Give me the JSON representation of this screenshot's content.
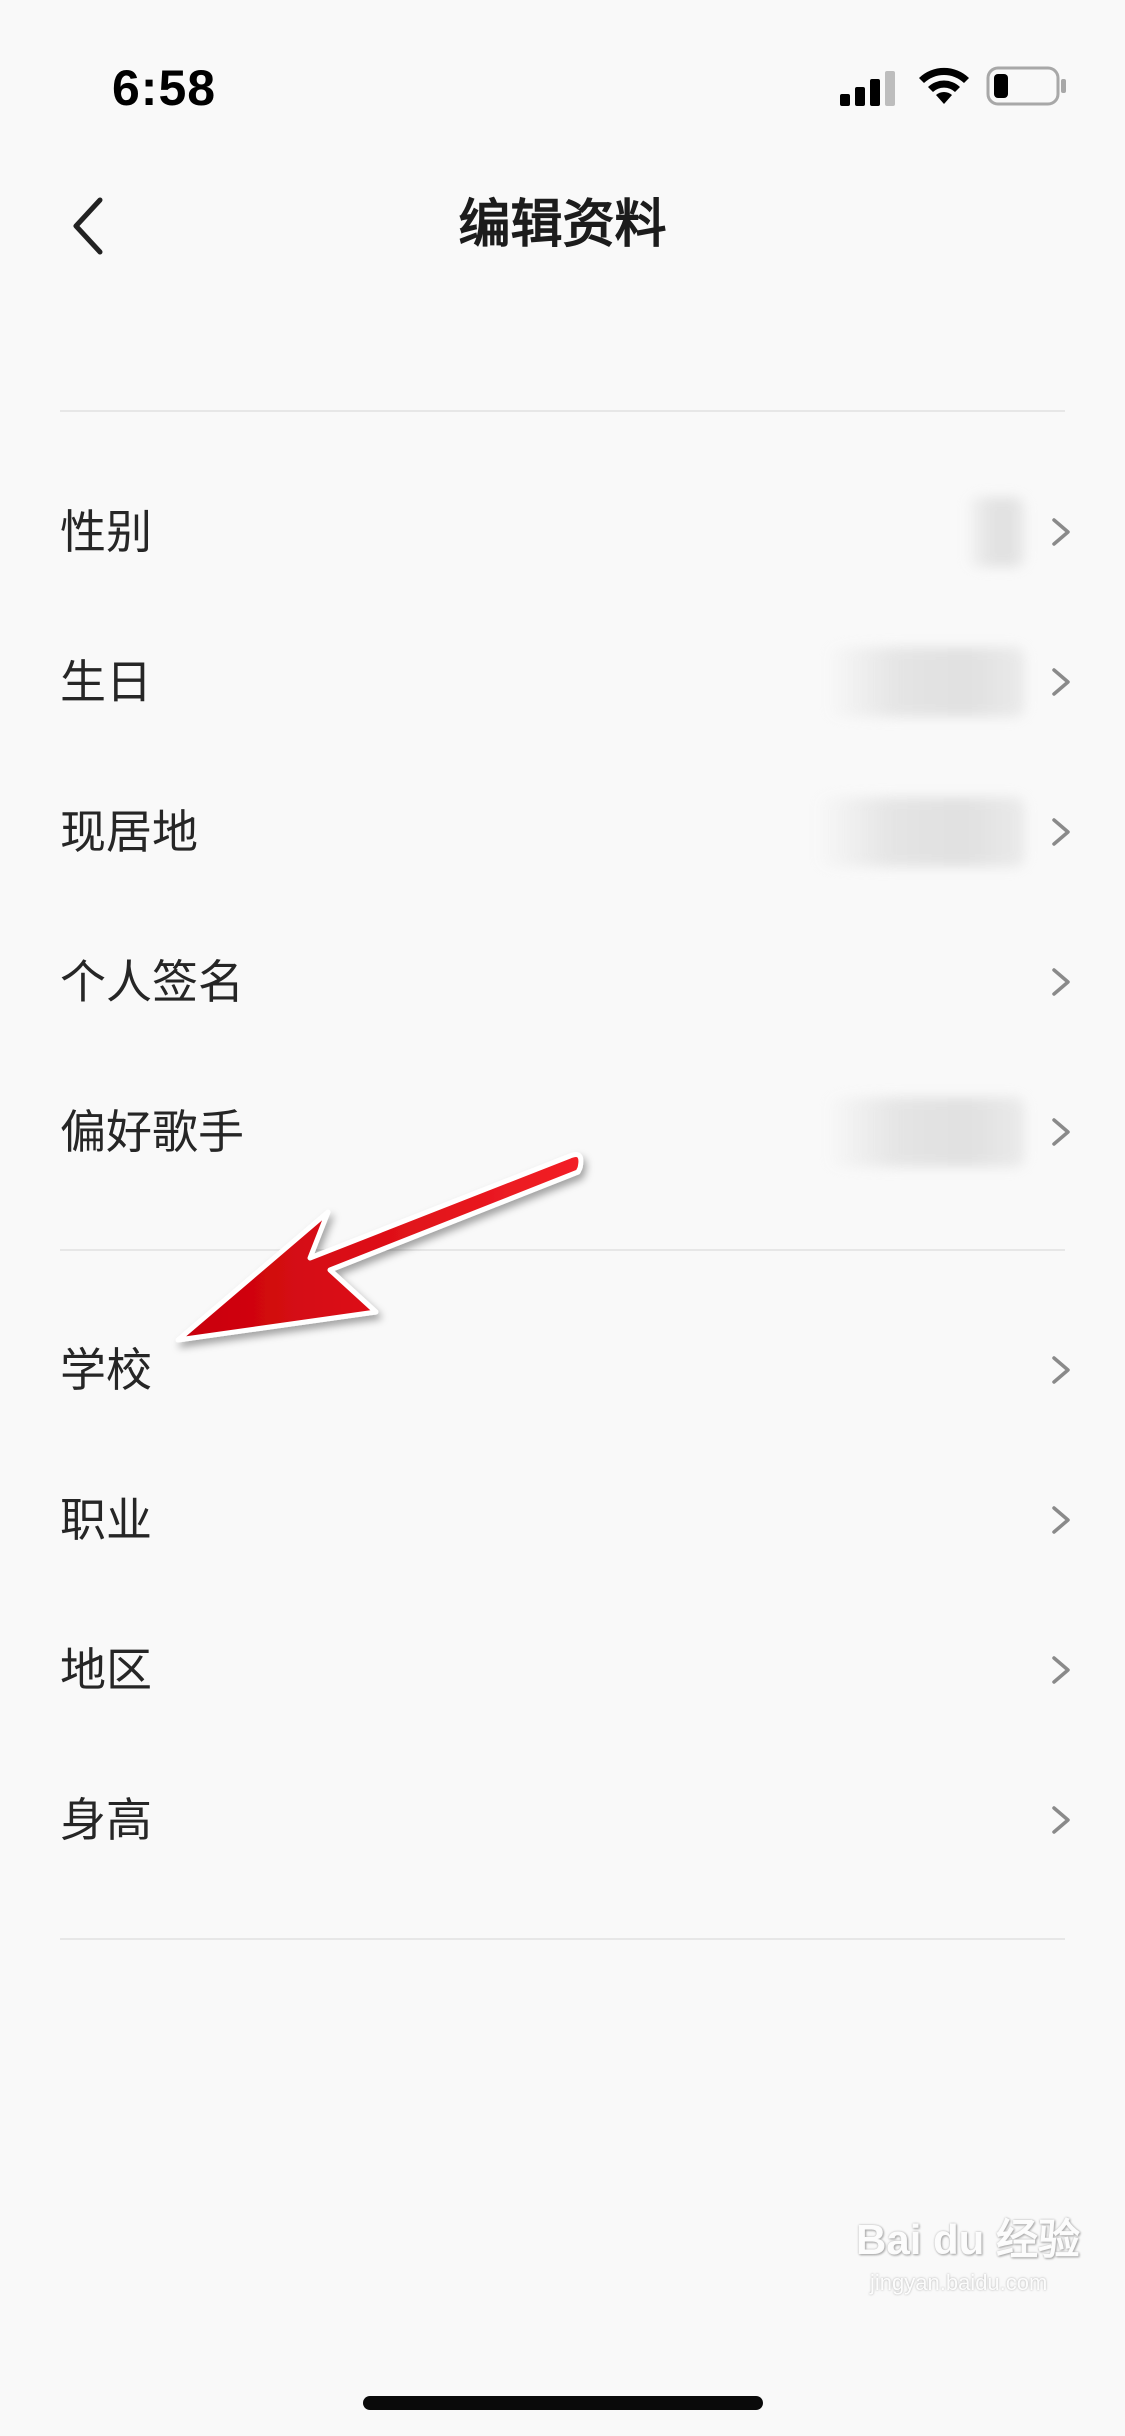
{
  "status_bar": {
    "time": "6:58",
    "icons": [
      "signal-icon",
      "wifi-icon",
      "battery-icon"
    ]
  },
  "nav": {
    "title": "编辑资料",
    "back_icon": "chevron-left-icon"
  },
  "sections": [
    {
      "rows": [
        {
          "label": "性别",
          "value_blurred": true
        },
        {
          "label": "生日",
          "value_blurred": true
        },
        {
          "label": "现居地",
          "value_blurred": true
        },
        {
          "label": "个人签名",
          "value_blurred": false
        },
        {
          "label": "偏好歌手",
          "value_blurred": true
        }
      ]
    },
    {
      "rows": [
        {
          "label": "学校",
          "value_blurred": false
        },
        {
          "label": "职业",
          "value_blurred": false
        },
        {
          "label": "地区",
          "value_blurred": false
        },
        {
          "label": "身高",
          "value_blurred": false
        }
      ]
    }
  ],
  "annotation": {
    "type": "red-arrow",
    "color": "#e8141b",
    "points_to": "学校"
  },
  "watermark": {
    "text": "Bai du 经验",
    "sub": "jingyan.baidu.com"
  }
}
